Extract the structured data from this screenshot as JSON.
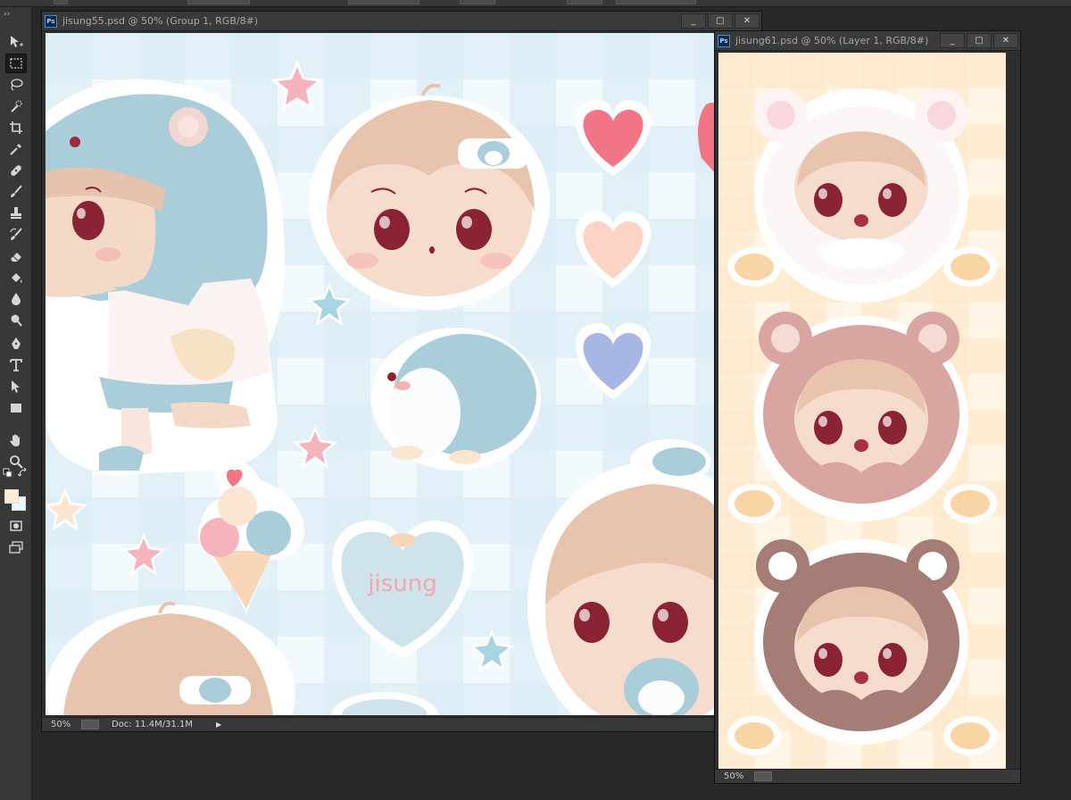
{
  "window1": {
    "title": "jisung55.psd @ 50% (Group 1, RGB/8#)",
    "zoom": "50%",
    "doc_info": "Doc: 11.4M/31.1M"
  },
  "window2": {
    "title": "jisung61.psd @ 50% (Layer 1, RGB/8#)",
    "zoom": "50%"
  },
  "canvas_text": "jisung",
  "ps_logo": "Ps",
  "controls": {
    "minimize": "_",
    "maximize": "▢",
    "close": "✕"
  },
  "colors": {
    "foreground": "#fdecd4",
    "background": "#e9f6fa",
    "ui_dark": "#282828",
    "panel": "#383838"
  },
  "tools": [
    "move-tool-icon",
    "marquee-tool-icon",
    "lasso-tool-icon",
    "quick-select-tool-icon",
    "crop-tool-icon",
    "eyedropper-tool-icon",
    "healing-brush-tool-icon",
    "brush-tool-icon",
    "clone-stamp-tool-icon",
    "history-brush-tool-icon",
    "eraser-tool-icon",
    "paint-bucket-tool-icon",
    "blur-tool-icon",
    "dodge-tool-icon",
    "pen-tool-icon",
    "type-tool-icon",
    "path-selection-tool-icon",
    "rectangle-tool-icon",
    "hand-tool-icon",
    "zoom-tool-icon"
  ]
}
